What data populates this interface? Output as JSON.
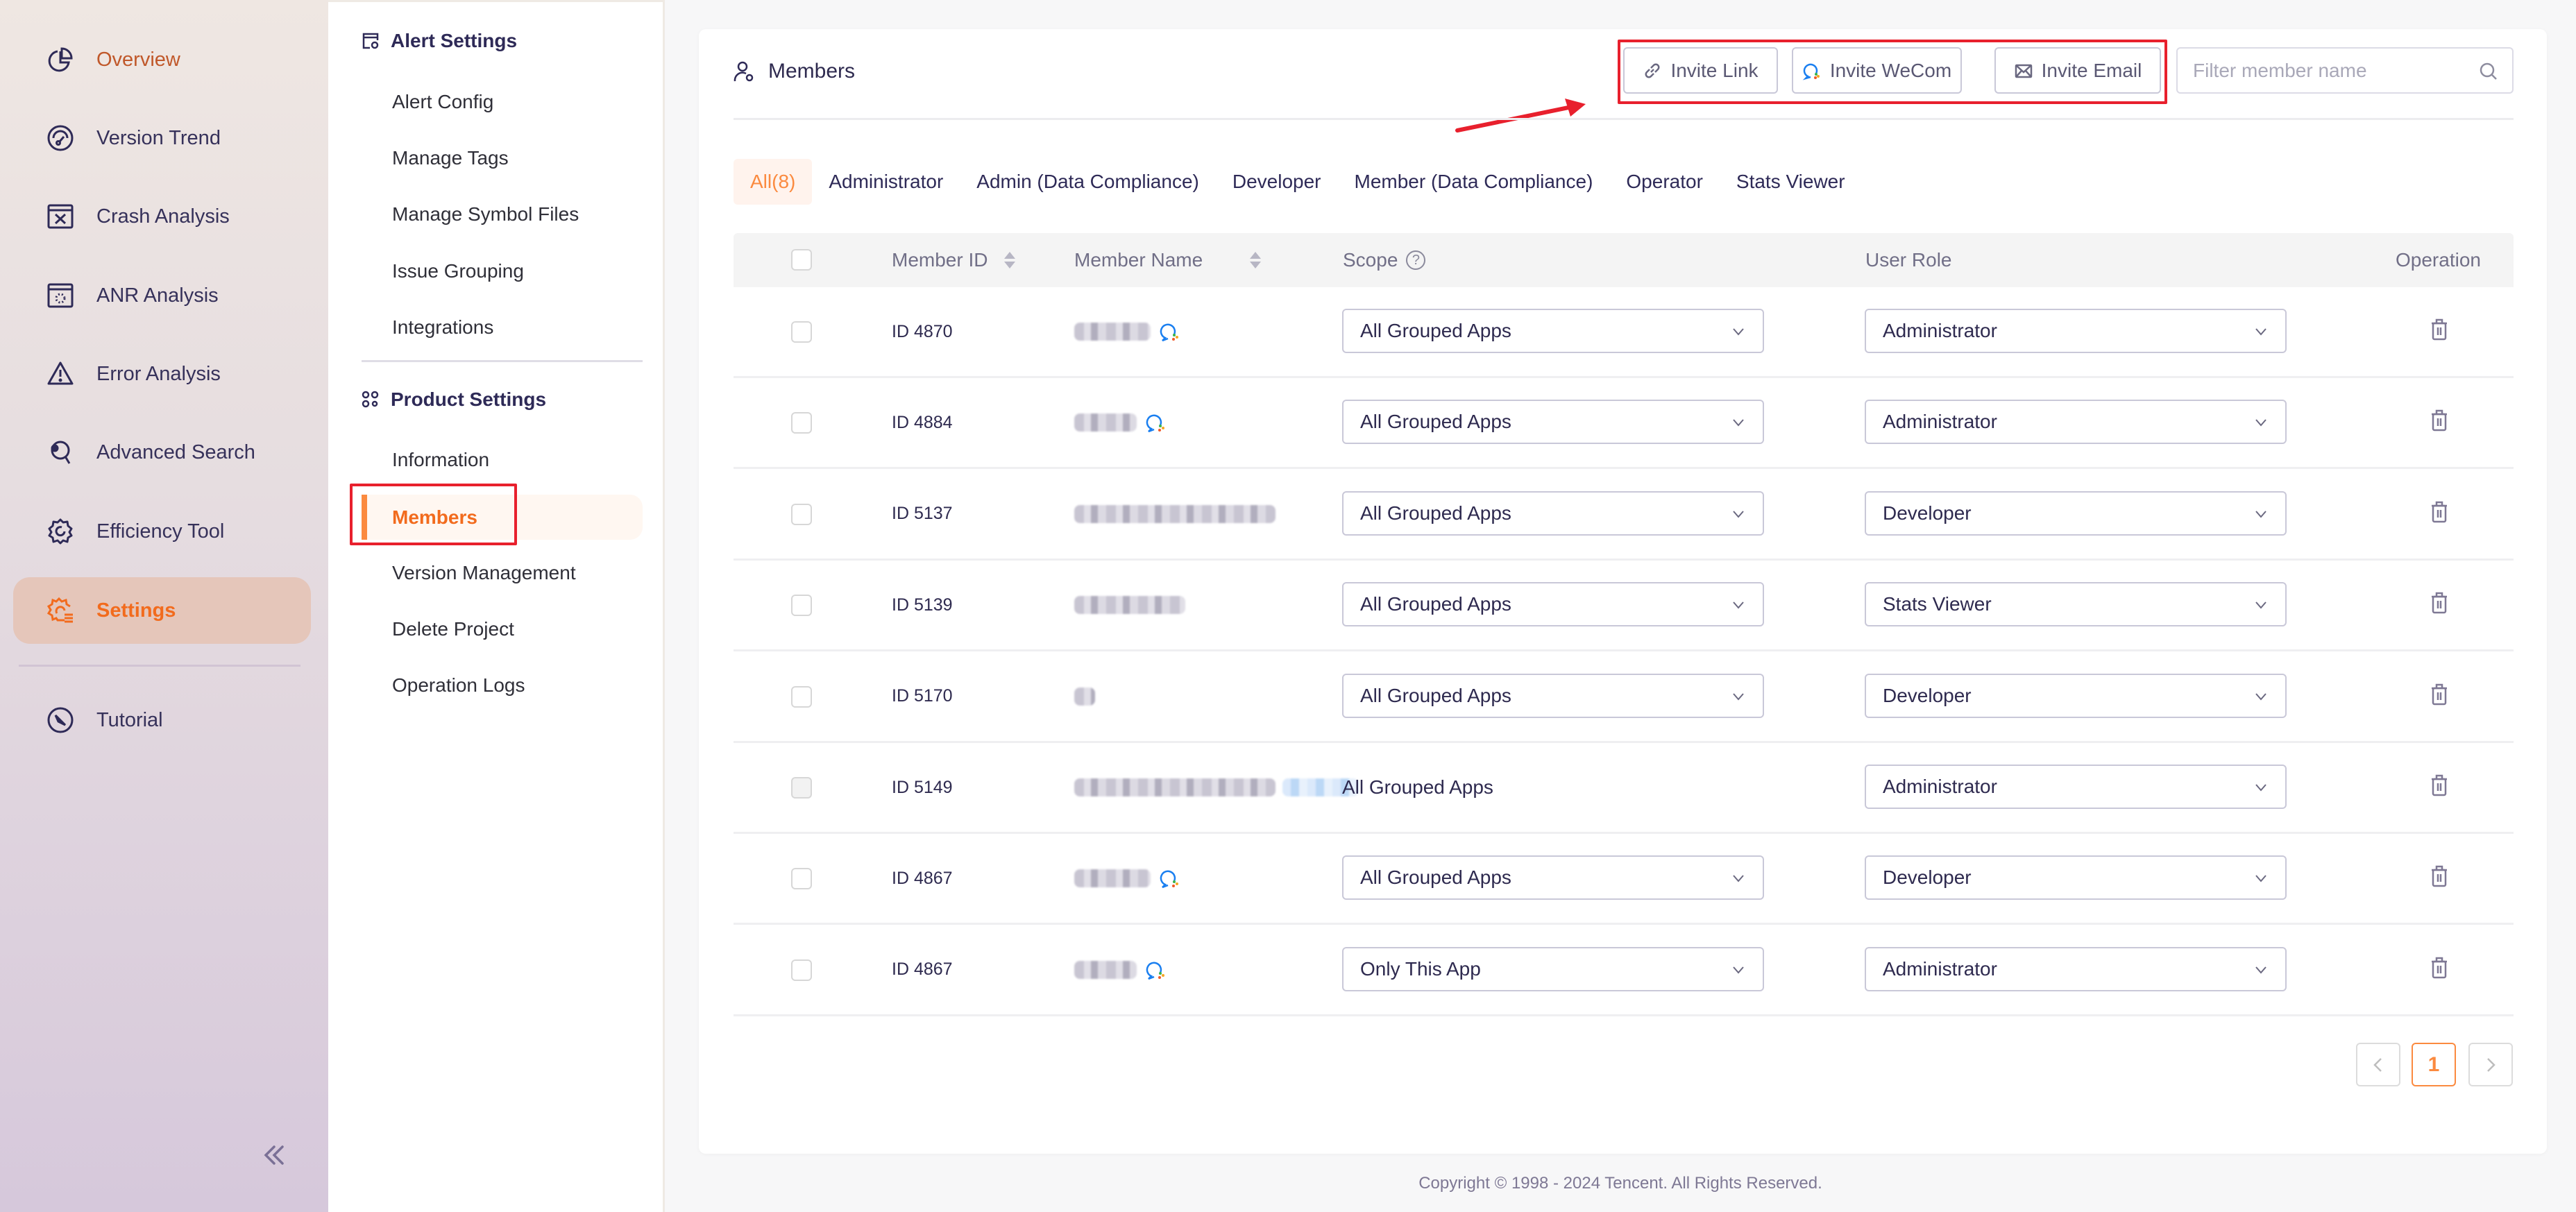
{
  "nav": {
    "items": [
      {
        "label": "Overview",
        "icon": "pie-chart-icon"
      },
      {
        "label": "Version Trend",
        "icon": "gauge-icon"
      },
      {
        "label": "Crash Analysis",
        "icon": "window-x-icon"
      },
      {
        "label": "ANR Analysis",
        "icon": "window-loading-icon"
      },
      {
        "label": "Error Analysis",
        "icon": "warning-triangle-icon"
      },
      {
        "label": "Advanced Search",
        "icon": "gear-search-icon"
      },
      {
        "label": "Efficiency Tool",
        "icon": "gear-refresh-icon"
      },
      {
        "label": "Settings",
        "icon": "gear-list-icon",
        "active": true
      },
      {
        "label": "Tutorial",
        "icon": "compass-icon"
      }
    ],
    "collapse_icon": "double-chevron-left-icon"
  },
  "subnav": {
    "alert_settings": {
      "title": "Alert Settings",
      "items": [
        "Alert Config",
        "Manage Tags",
        "Manage Symbol Files",
        "Issue Grouping",
        "Integrations"
      ]
    },
    "product_settings": {
      "title": "Product Settings",
      "items": [
        "Information",
        "Members",
        "Version Management",
        "Delete Project",
        "Operation Logs"
      ],
      "active": "Members"
    }
  },
  "main": {
    "title": "Members",
    "buttons": {
      "invite_link": "Invite Link",
      "invite_wecom": "Invite WeCom",
      "invite_email": "Invite Email"
    },
    "search": {
      "placeholder": "Filter member name",
      "value": ""
    },
    "tabs": [
      {
        "label": "All(8)",
        "active": true
      },
      {
        "label": "Administrator"
      },
      {
        "label": "Admin (Data Compliance)"
      },
      {
        "label": "Developer"
      },
      {
        "label": "Member (Data Compliance)"
      },
      {
        "label": "Operator"
      },
      {
        "label": "Stats Viewer"
      }
    ],
    "table": {
      "columns": {
        "member_id": "Member ID",
        "member_name": "Member Name",
        "scope": "Scope",
        "user_role": "User Role",
        "operation": "Operation"
      },
      "rows": [
        {
          "id": "ID 4870",
          "name": "[blurred]",
          "wecom": true,
          "scope": "All Grouped Apps",
          "scope_editable": true,
          "role": "Administrator"
        },
        {
          "id": "ID 4884",
          "name": "[blurred]",
          "wecom": true,
          "scope": "All Grouped Apps",
          "scope_editable": true,
          "role": "Administrator"
        },
        {
          "id": "ID 5137",
          "name": "[blurred]",
          "wecom": false,
          "scope": "All Grouped Apps",
          "scope_editable": true,
          "role": "Developer"
        },
        {
          "id": "ID 5139",
          "name": "[blurred]",
          "wecom": false,
          "scope": "All Grouped Apps",
          "scope_editable": true,
          "role": "Stats Viewer"
        },
        {
          "id": "ID 5170",
          "name": "[blurred]",
          "wecom": false,
          "scope": "All Grouped Apps",
          "scope_editable": true,
          "role": "Developer"
        },
        {
          "id": "ID 5149",
          "name": "[blurred]",
          "wecom": false,
          "scope": "All Grouped Apps",
          "scope_editable": false,
          "checkbox_disabled": true,
          "role": "Administrator"
        },
        {
          "id": "ID 4867",
          "name": "[blurred]",
          "wecom": true,
          "scope": "All Grouped Apps",
          "scope_editable": true,
          "role": "Developer"
        },
        {
          "id": "ID 4867",
          "name": "[blurred]",
          "wecom": true,
          "scope": "Only This App",
          "scope_editable": true,
          "role": "Administrator"
        }
      ]
    },
    "pagination": {
      "current": "1",
      "prev": "‹",
      "next": "›"
    }
  },
  "footer": "Copyright © 1998 - 2024 Tencent. All Rights Reserved.",
  "colors": {
    "accent": "#f26b1d",
    "accent_light": "#fb8a3f",
    "annotation_red": "#e8202d"
  }
}
